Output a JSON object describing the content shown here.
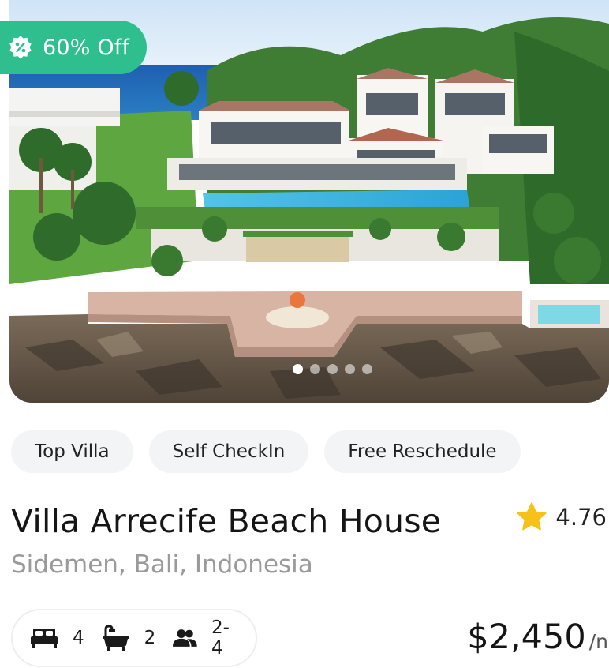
{
  "listing": {
    "discount_label": "60% Off",
    "photo_alt": "Luxury cliffside villa with pool overlooking the ocean",
    "carousel": {
      "count": 5,
      "active_index": 0
    },
    "tags": [
      "Top Villa",
      "Self CheckIn",
      "Free Reschedule"
    ],
    "title": "Villa Arrecife Beach House",
    "location": "Sidemen, Bali, Indonesia",
    "rating": "4.76",
    "amenities": {
      "bedrooms": "4",
      "bathrooms": "2",
      "guests": "2-4"
    },
    "price": "$2,450",
    "price_unit": "/n"
  },
  "colors": {
    "accent_green": "#2fbf8f",
    "star": "#f6c21a",
    "chip_bg": "#f3f4f6",
    "muted_text": "#9a9a9a"
  },
  "icons": {
    "discount": "discount-tag-icon",
    "rating": "star-icon",
    "bedrooms": "bed-icon",
    "bathrooms": "bathtub-icon",
    "guests": "guests-icon"
  }
}
